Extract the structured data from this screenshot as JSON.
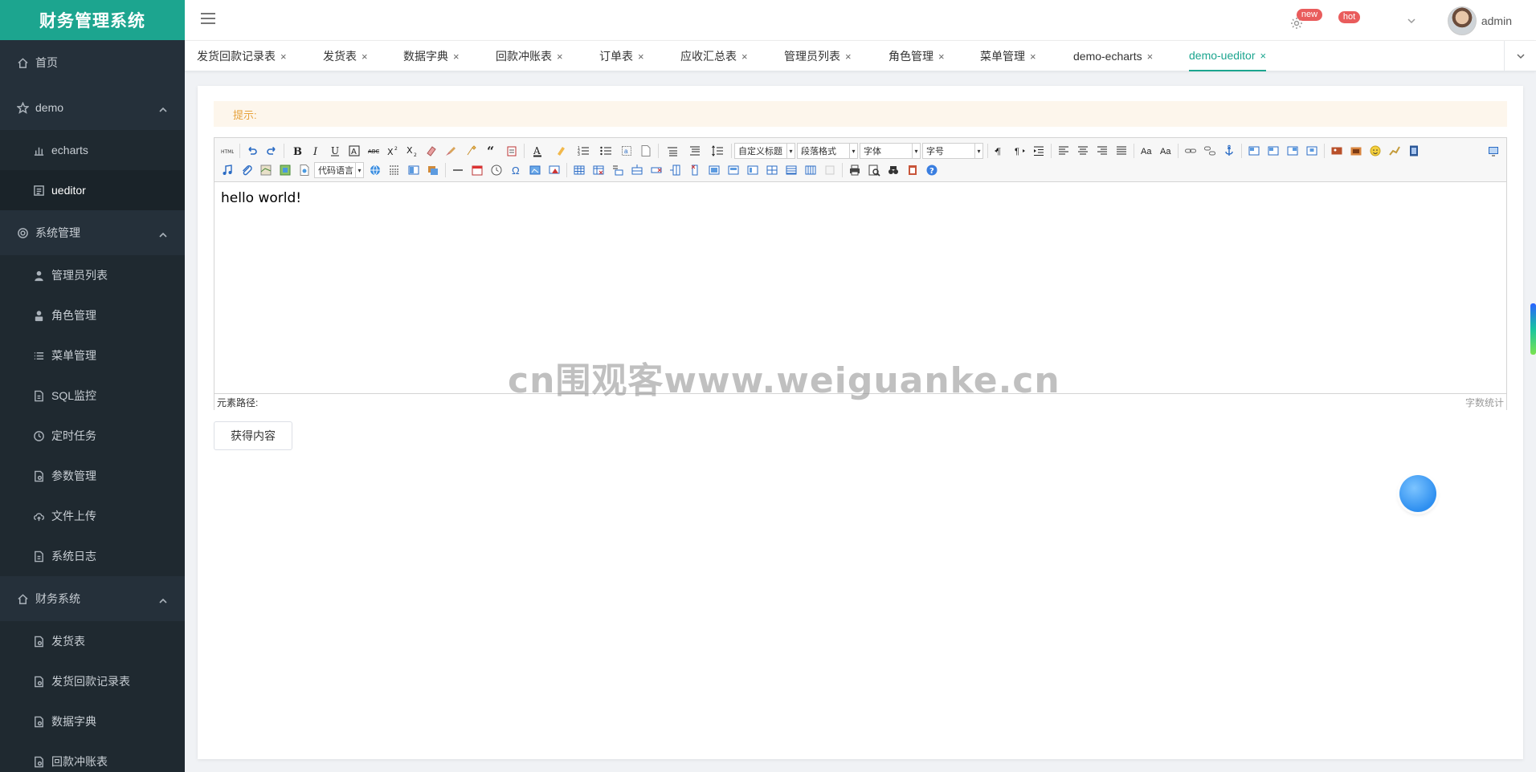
{
  "app": {
    "title": "财务管理系统"
  },
  "sidebar": {
    "home": "首页",
    "demo": {
      "label": "demo",
      "items": [
        "echarts",
        "ueditor"
      ]
    },
    "system": {
      "label": "系统管理",
      "items": [
        "管理员列表",
        "角色管理",
        "菜单管理",
        "SQL监控",
        "定时任务",
        "参数管理",
        "文件上传",
        "系统日志"
      ]
    },
    "finance": {
      "label": "财务系统",
      "items": [
        "发货表",
        "发货回款记录表",
        "数据字典",
        "回款冲账表"
      ]
    }
  },
  "header": {
    "badge_new": "new",
    "badge_hot": "hot",
    "username": "admin"
  },
  "tabs": [
    "发货回款记录表",
    "发货表",
    "数据字典",
    "回款冲账表",
    "订单表",
    "应收汇总表",
    "管理员列表",
    "角色管理",
    "菜单管理",
    "demo-echarts",
    "demo-ueditor"
  ],
  "tab_close": "×",
  "content": {
    "tip": "提示:",
    "editor": {
      "combos": {
        "code_lang": "代码语言",
        "custom_title": "自定义标题",
        "paragraph": "段落格式",
        "font": "字体",
        "size": "字号"
      },
      "body": "hello world!",
      "path_label": "元素路径:",
      "word_count": "字数统计"
    },
    "get_button": "获得内容",
    "watermark": "cn围观客www.weiguanke.cn"
  }
}
